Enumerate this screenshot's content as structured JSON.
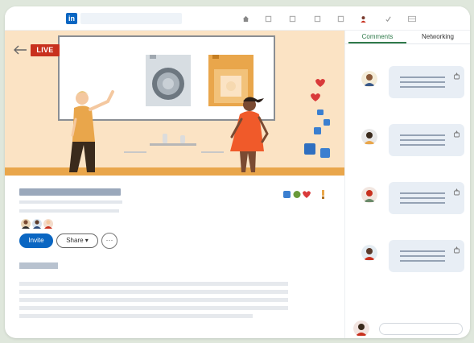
{
  "app": {
    "logo_text": "in",
    "nav_icons": [
      "home-icon",
      "network-icon",
      "jobs-icon",
      "messaging-icon",
      "notifications-icon",
      "me-avatar-icon",
      "work-icon",
      "grid-icon"
    ]
  },
  "stream": {
    "live_label": "LIVE"
  },
  "actions": {
    "invite_label": "Invite",
    "share_label": "Share ▾",
    "more_label": "···"
  },
  "reactions": [
    "like-icon",
    "celebrate-icon",
    "love-icon",
    "insightful-icon"
  ],
  "sidebar": {
    "tabs": [
      {
        "label": "Comments",
        "active": true
      },
      {
        "label": "Networking",
        "active": false
      }
    ],
    "comment_count": 4
  },
  "colors": {
    "brand": "#0a66c2",
    "live": "#c8301e",
    "hero_bg": "#fbe3c4",
    "floor": "#e9a64b",
    "tab_active": "#2f7a4a",
    "bubble": "#e8eef5"
  }
}
